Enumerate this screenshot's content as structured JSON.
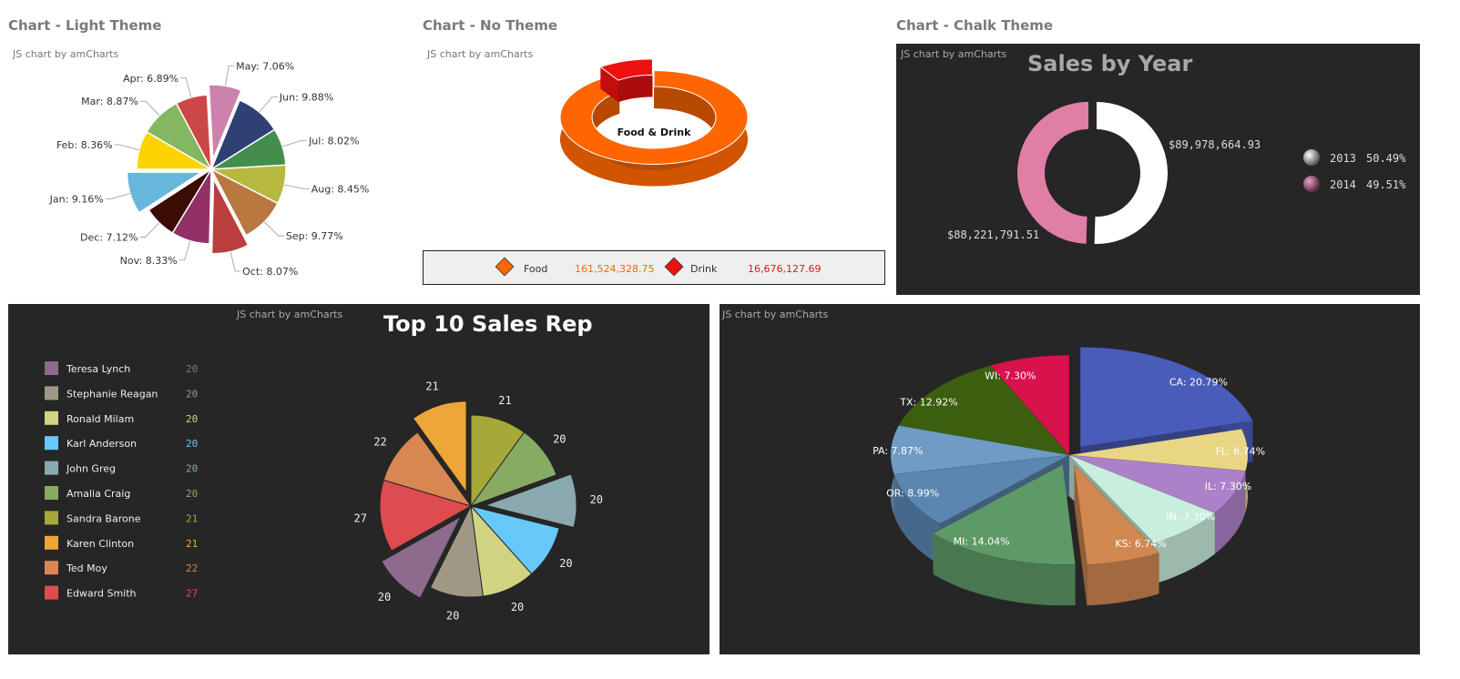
{
  "titles": {
    "light": "Chart - Light Theme",
    "none": "Chart - No Theme",
    "chalk": "Chart - Chalk Theme"
  },
  "credit": "JS chart by amCharts",
  "chart_data": [
    {
      "id": "light-pie",
      "type": "pie",
      "title": "",
      "slices": [
        {
          "label": "Jan",
          "value": 9.16,
          "pulled": true,
          "color": "#67b7dc"
        },
        {
          "label": "Feb",
          "value": 8.36,
          "pulled": false,
          "color": "#fdd400"
        },
        {
          "label": "Mar",
          "value": 8.87,
          "pulled": false,
          "color": "#84b761"
        },
        {
          "label": "Apr",
          "value": 6.89,
          "pulled": false,
          "color": "#cc4748"
        },
        {
          "label": "May",
          "value": 7.06,
          "pulled": true,
          "color": "#cd82ad"
        },
        {
          "label": "Jun",
          "value": 9.88,
          "pulled": false,
          "color": "#2f4074"
        },
        {
          "label": "Jul",
          "value": 8.02,
          "pulled": false,
          "color": "#448e4d"
        },
        {
          "label": "Aug",
          "value": 8.45,
          "pulled": false,
          "color": "#b7b83f"
        },
        {
          "label": "Sep",
          "value": 9.77,
          "pulled": false,
          "color": "#b9783f"
        },
        {
          "label": "Oct",
          "value": 8.07,
          "pulled": true,
          "color": "#b93e3d"
        },
        {
          "label": "Nov",
          "value": 8.33,
          "pulled": false,
          "color": "#913167"
        },
        {
          "label": "Dec",
          "value": 7.12,
          "pulled": false,
          "color": "#3a0c02"
        }
      ]
    },
    {
      "id": "food-drink-donut",
      "type": "pie",
      "center_label": "Food & Drink",
      "slices": [
        {
          "label": "Food",
          "value": 161524328.75,
          "display": "161,524,328.75",
          "color": "#ff6600"
        },
        {
          "label": "Drink",
          "value": 16676127.69,
          "display": "16,676,127.69",
          "color": "#ee1111"
        }
      ]
    },
    {
      "id": "sales-by-year",
      "type": "pie",
      "title": "Sales by Year",
      "slices": [
        {
          "label": "2013",
          "value": 89978664.93,
          "display": "$89,978,664.93",
          "percent": "50.49%",
          "color": "#ffffff"
        },
        {
          "label": "2014",
          "value": 88221791.51,
          "display": "$88,221,791.51",
          "percent": "49.51%",
          "color": "#e07ea5"
        }
      ]
    },
    {
      "id": "top10-reps",
      "type": "pie",
      "title": "Top 10 Sales Rep",
      "slices": [
        {
          "label": "Teresa Lynch",
          "value": 20,
          "color": "#8c6b8c"
        },
        {
          "label": "Stephanie Reagan",
          "value": 20,
          "color": "#a09885"
        },
        {
          "label": "Ronald Milam",
          "value": 20,
          "color": "#d0d381"
        },
        {
          "label": "Karl Anderson",
          "value": 20,
          "color": "#67c9fa"
        },
        {
          "label": "John Greg",
          "value": 20,
          "color": "#8aa9ae"
        },
        {
          "label": "Amalia Craig",
          "value": 20,
          "color": "#88ab63"
        },
        {
          "label": "Sandra Barone",
          "value": 21,
          "color": "#a6a83a"
        },
        {
          "label": "Karen Clinton",
          "value": 21,
          "color": "#eea638"
        },
        {
          "label": "Ted Moy",
          "value": 22,
          "color": "#d98752"
        },
        {
          "label": "Edward Smith",
          "value": 27,
          "color": "#de4c4f"
        }
      ]
    },
    {
      "id": "state-pie-3d",
      "type": "pie",
      "title": "",
      "slices": [
        {
          "label": "CA",
          "value": 20.79,
          "color": "#4a5cba"
        },
        {
          "label": "FL",
          "value": 6.74,
          "color": "#e8d685"
        },
        {
          "label": "IL",
          "value": 7.3,
          "color": "#ad81c9"
        },
        {
          "label": "IN",
          "value": 7.3,
          "color": "#c8eedd"
        },
        {
          "label": "KS",
          "value": 6.74,
          "color": "#d08850"
        },
        {
          "label": "MI",
          "value": 14.04,
          "color": "#5e9a67"
        },
        {
          "label": "OR",
          "value": 8.99,
          "color": "#5b86b0"
        },
        {
          "label": "PA",
          "value": 7.87,
          "color": "#6f9bc4"
        },
        {
          "label": "TX",
          "value": 12.92,
          "color": "#3c5e0f"
        },
        {
          "label": "WI",
          "value": 7.3,
          "color": "#d8124d"
        }
      ]
    }
  ]
}
